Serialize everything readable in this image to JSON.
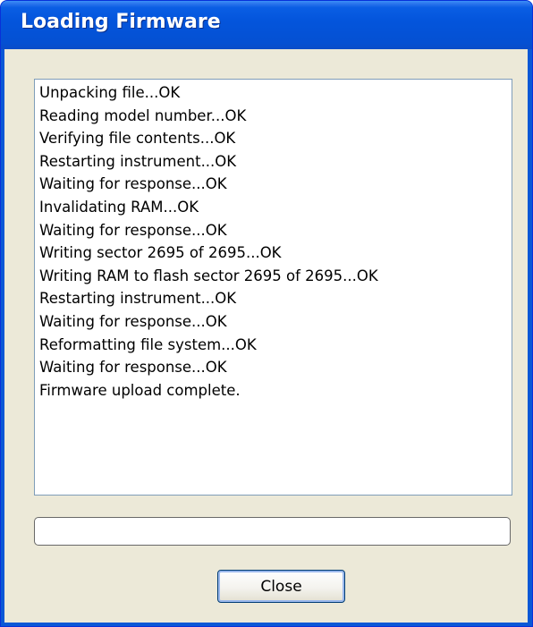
{
  "window": {
    "title": "Loading Firmware"
  },
  "log": {
    "lines": [
      "Unpacking file...OK",
      "Reading model number...OK",
      "Verifying file contents...OK",
      "Restarting instrument...OK",
      "Waiting for response...OK",
      "Invalidating RAM...OK",
      "Waiting for response...OK",
      "Writing sector 2695 of 2695...OK",
      "Writing RAM to flash sector 2695 of 2695...OK",
      "Restarting instrument...OK",
      "Waiting for response...OK",
      "Reformatting file system...OK",
      "Waiting for response...OK",
      "Firmware upload complete."
    ]
  },
  "progress": {
    "fraction": 0
  },
  "buttons": {
    "close_label": "Close"
  },
  "colors": {
    "title_bar": "#0455dc",
    "dialog_background": "#ece9d8",
    "log_border": "#7f9db9"
  }
}
